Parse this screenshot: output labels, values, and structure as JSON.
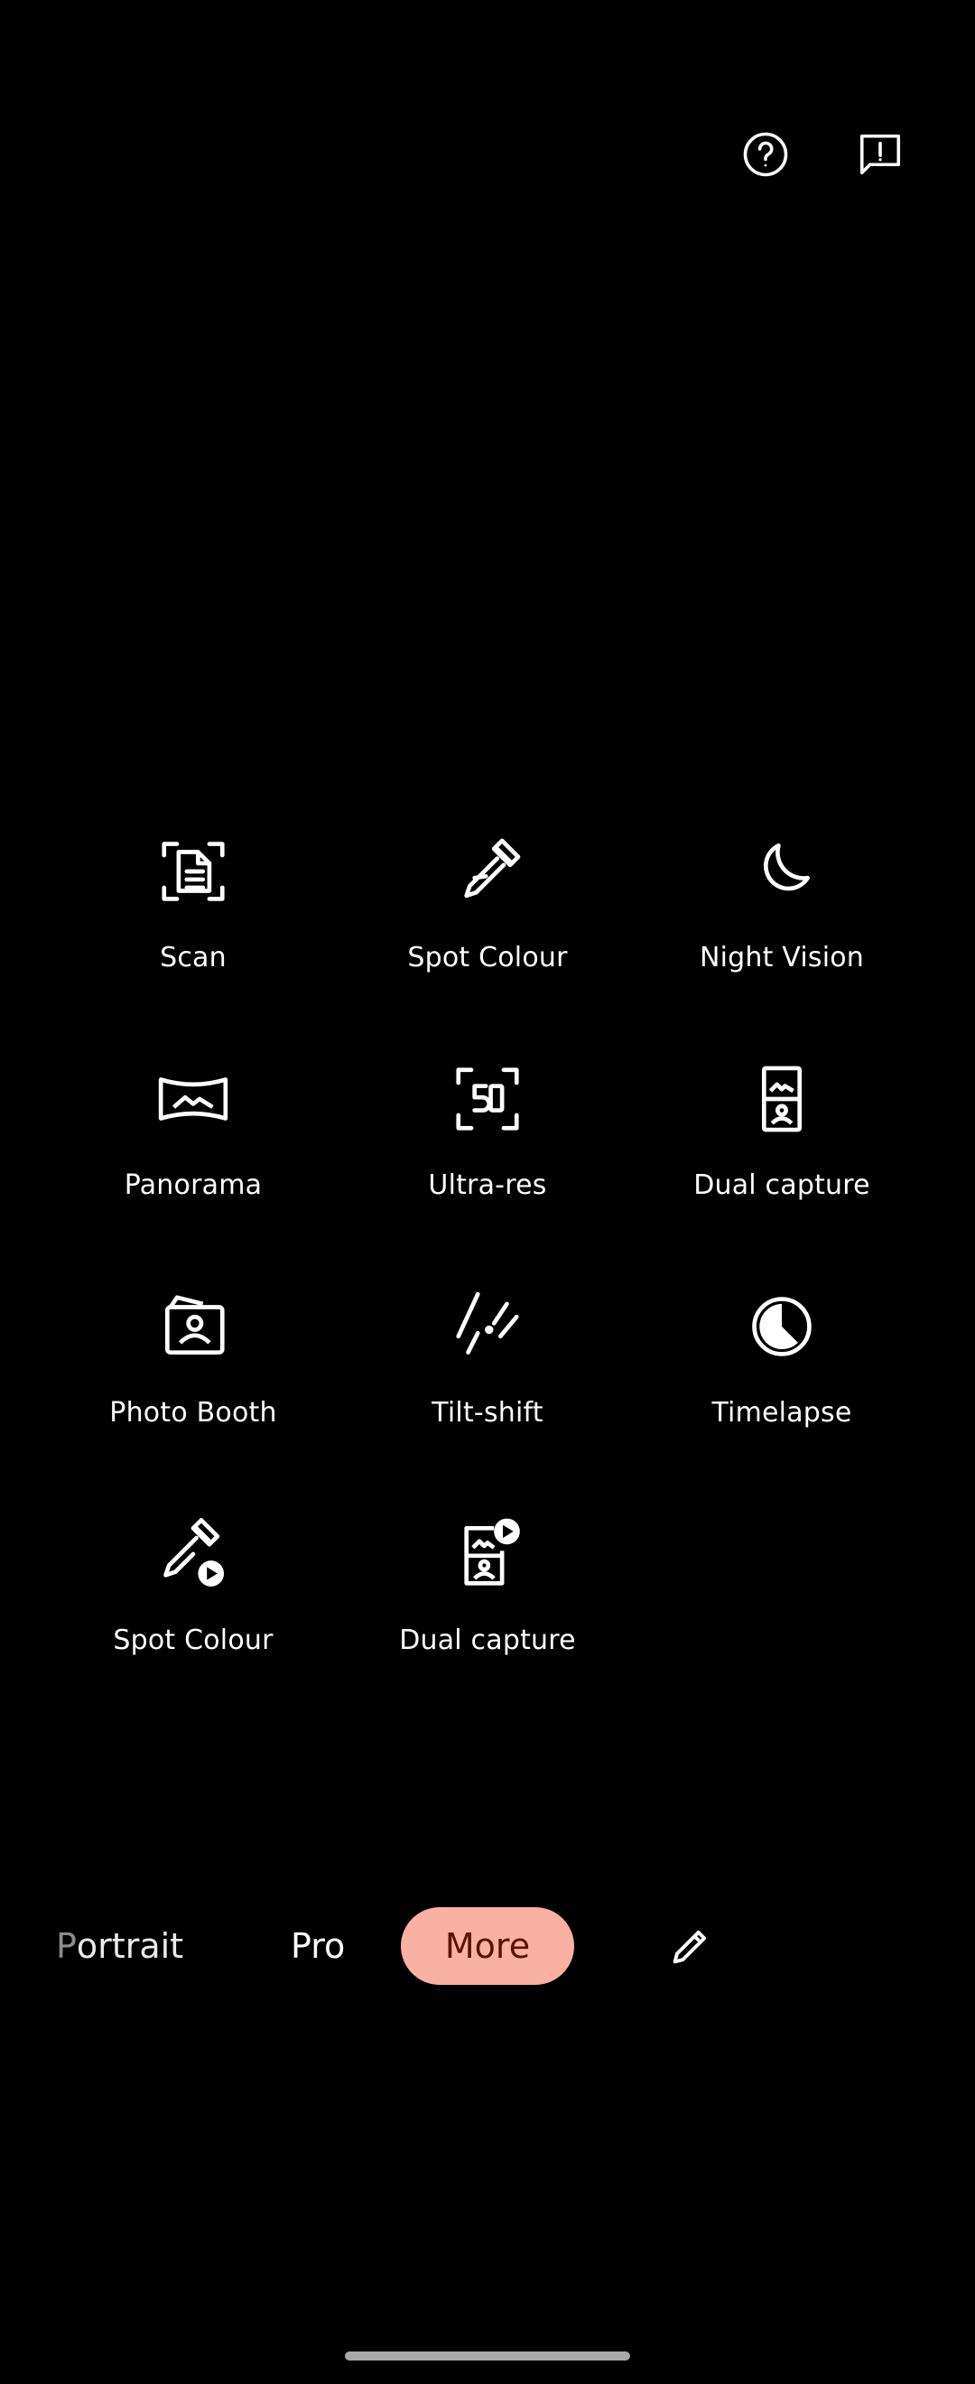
{
  "top_actions": {
    "help_icon": "help-circle-icon",
    "feedback_icon": "feedback-icon"
  },
  "modes": [
    {
      "label": "Scan",
      "icon": "document-scan-icon"
    },
    {
      "label": "Spot Colour",
      "icon": "eyedropper-icon"
    },
    {
      "label": "Night Vision",
      "icon": "moon-icon"
    },
    {
      "label": "Panorama",
      "icon": "panorama-icon"
    },
    {
      "label": "Ultra-res",
      "icon": "ultra-res-50-icon"
    },
    {
      "label": "Dual capture",
      "icon": "dual-capture-icon"
    },
    {
      "label": "Photo Booth",
      "icon": "photo-booth-icon"
    },
    {
      "label": "Tilt-shift",
      "icon": "tilt-shift-icon"
    },
    {
      "label": "Timelapse",
      "icon": "timelapse-icon"
    },
    {
      "label": "Spot Colour",
      "icon": "eyedropper-video-icon"
    },
    {
      "label": "Dual capture",
      "icon": "dual-capture-video-icon"
    }
  ],
  "switcher": {
    "portrait_first": "P",
    "portrait_rest": "ortrait",
    "pro": "Pro",
    "more": "More",
    "edit_icon": "pencil-icon"
  },
  "colors": {
    "background": "#000000",
    "active_pill": "#f9b1a2",
    "active_text": "#5a1208"
  }
}
